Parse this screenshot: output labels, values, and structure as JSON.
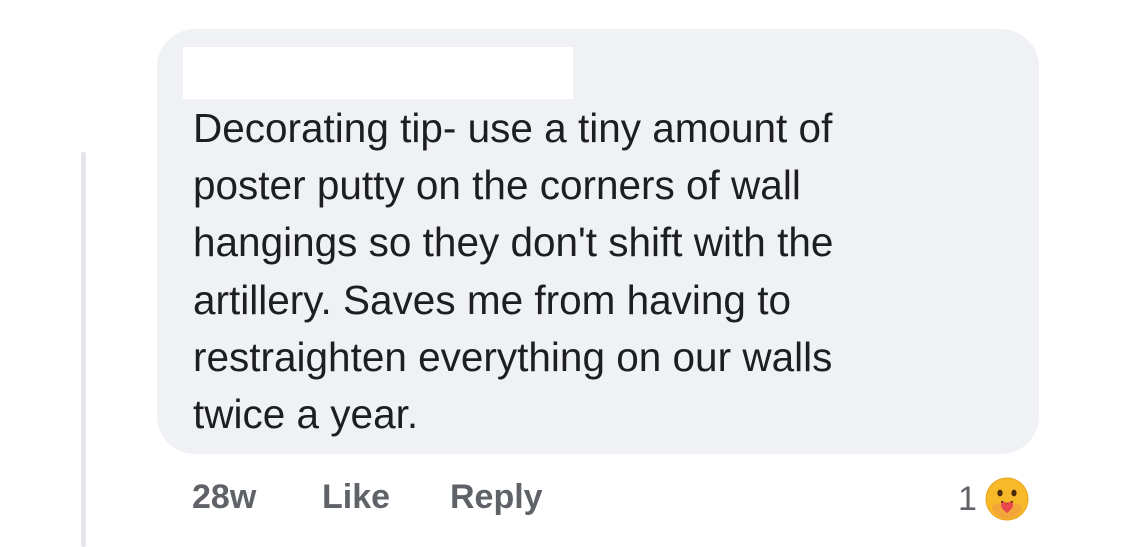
{
  "comment": {
    "text": "Decorating tip- use a tiny amount of\nposter putty on the corners of wall\nhangings so they don't shift with the\nartillery. Saves me from having to\nrestraighten everything on our walls\ntwice a year."
  },
  "actions": {
    "timestamp": "28w",
    "like_label": "Like",
    "reply_label": "Reply"
  },
  "reactions": {
    "count": "1",
    "icon": "care-reaction-icon",
    "icon_color": "#f7b928"
  },
  "colors": {
    "bubble": "#f0f1f5",
    "text": "#1c1e21",
    "meta": "#5f6368",
    "thread_line": "#e4e6ea"
  }
}
